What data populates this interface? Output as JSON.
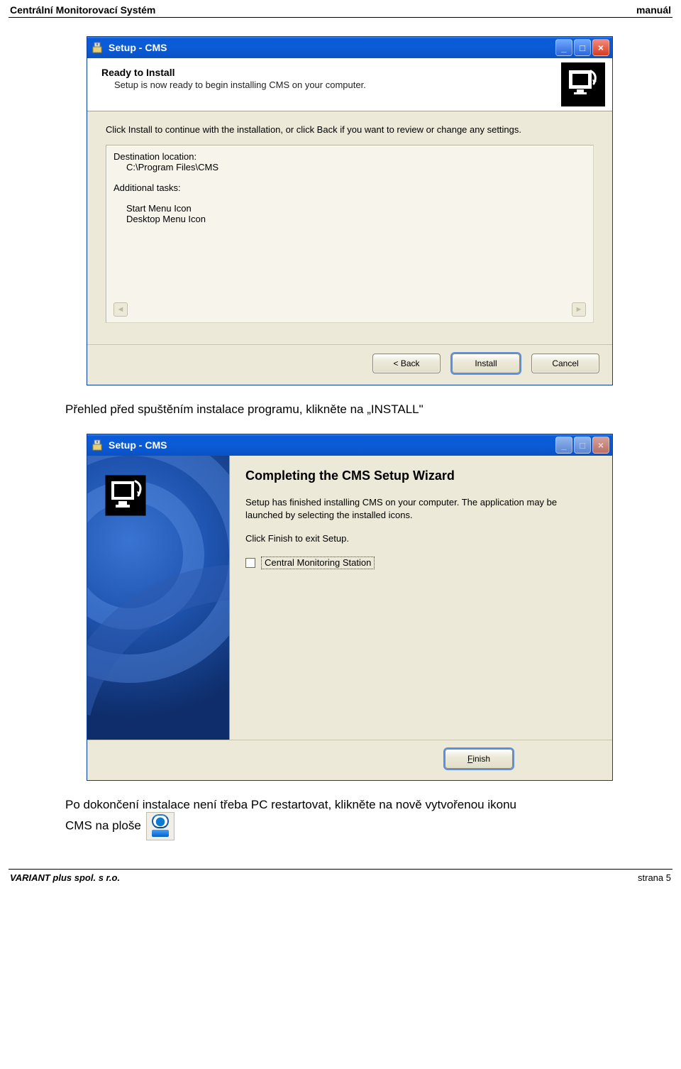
{
  "page": {
    "header_left": "Centrální Monitorovací Systém",
    "header_right": "manuál",
    "footer_left": "VARIANT plus spol. s r.o.",
    "footer_right": "strana 5"
  },
  "caption1": "Přehled před spuštěním instalace programu, klikněte na „INSTALL\"",
  "caption2_a": "Po dokončení instalace není třeba PC restartovat, klikněte na nově vytvořenou ikonu",
  "caption2_b": "CMS na ploše",
  "win1": {
    "title": "Setup - CMS",
    "head_title": "Ready to Install",
    "head_sub": "Setup is now ready to begin installing CMS on your computer.",
    "instructions": "Click Install to continue with the installation, or click Back if you want to review or change any settings.",
    "summary": {
      "dest_label": "Destination location:",
      "dest_value": "C:\\Program Files\\CMS",
      "tasks_label": "Additional tasks:",
      "tasks": [
        "Start Menu Icon",
        "Desktop Menu Icon"
      ]
    },
    "back": "< Back",
    "install": "Install",
    "cancel": "Cancel",
    "minimize": "_",
    "maximize": "□",
    "close": "×"
  },
  "win2": {
    "title": "Setup - CMS",
    "big_title": "Completing the CMS Setup Wizard",
    "p1": "Setup has finished installing CMS on your computer. The application may be launched by selecting the installed icons.",
    "p2": "Click Finish to exit Setup.",
    "checkbox_label": "Central Monitoring Station",
    "finish_pre": "",
    "finish_underline": "F",
    "finish_rest": "inish",
    "minimize": "_",
    "maximize": "□",
    "close": "×"
  },
  "icons": {
    "installer": "installer-icon",
    "monitor": "monitor-icon",
    "desktop": "cms-desktop-icon"
  }
}
